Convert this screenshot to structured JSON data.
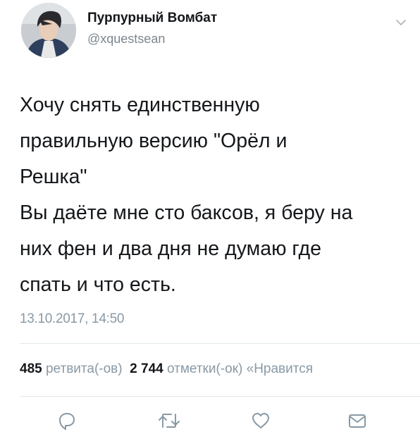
{
  "user": {
    "display_name": "Пурпурный Вомбат",
    "handle": "@xquestsean"
  },
  "tweet": {
    "lines": [
      "Хочу снять единственную",
      "правильную версию \"Орёл и",
      "Решка\"",
      "Вы даёте мне сто баксов, я беру на",
      "них фен и два дня не думаю где",
      "спать и что есть."
    ],
    "timestamp": "13.10.2017, 14:50"
  },
  "stats": {
    "retweets_count": "485",
    "retweets_label": "ретвита(-ов)",
    "likes_count": "2 744",
    "likes_label": "отметки(-ок)",
    "third_label": "«Нравится"
  },
  "icons": {
    "caret": "chevron-down-icon",
    "reply": "reply-icon",
    "retweet": "retweet-icon",
    "like": "heart-icon",
    "dm": "message-icon"
  },
  "colors": {
    "text": "#14171a",
    "muted": "#8899a6",
    "divider": "#e1e8ed"
  }
}
